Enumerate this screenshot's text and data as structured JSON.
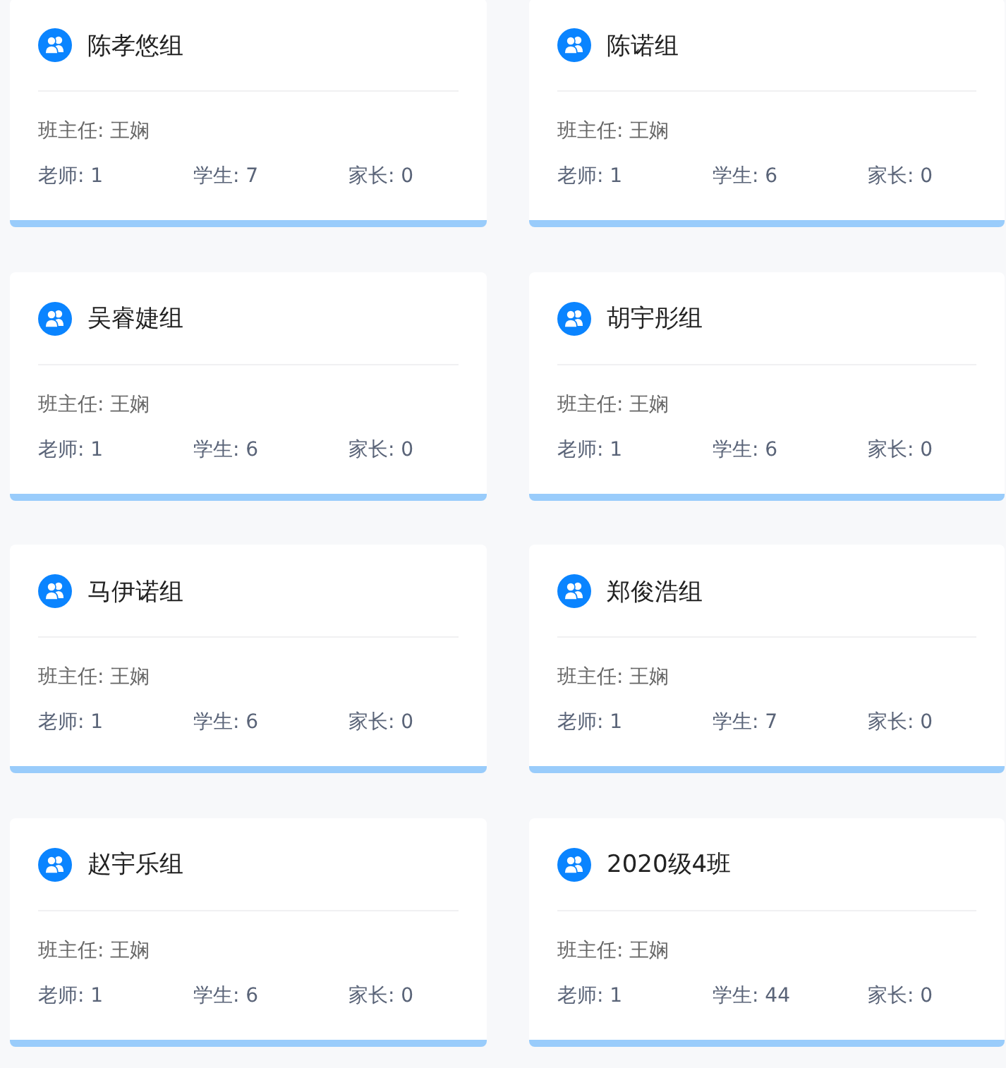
{
  "groups": [
    {
      "name": "陈孝悠组",
      "head_teacher": "班主任: 王娴",
      "teachers": "老师: 1",
      "students": "学生: 7",
      "parents": "家长: 0"
    },
    {
      "name": "陈诺组",
      "head_teacher": "班主任: 王娴",
      "teachers": "老师: 1",
      "students": "学生: 6",
      "parents": "家长: 0"
    },
    {
      "name": "吴睿婕组",
      "head_teacher": "班主任: 王娴",
      "teachers": "老师: 1",
      "students": "学生: 6",
      "parents": "家长: 0"
    },
    {
      "name": "胡宇彤组",
      "head_teacher": "班主任: 王娴",
      "teachers": "老师: 1",
      "students": "学生: 6",
      "parents": "家长: 0"
    },
    {
      "name": "马伊诺组",
      "head_teacher": "班主任: 王娴",
      "teachers": "老师: 1",
      "students": "学生: 6",
      "parents": "家长: 0"
    },
    {
      "name": "郑俊浩组",
      "head_teacher": "班主任: 王娴",
      "teachers": "老师: 1",
      "students": "学生: 7",
      "parents": "家长: 0"
    },
    {
      "name": "赵宇乐组",
      "head_teacher": "班主任: 王娴",
      "teachers": "老师: 1",
      "students": "学生: 6",
      "parents": "家长: 0"
    },
    {
      "name": "2020级4班",
      "head_teacher": "班主任: 王娴",
      "teachers": "老师: 1",
      "students": "学生: 44",
      "parents": "家长: 0"
    }
  ]
}
